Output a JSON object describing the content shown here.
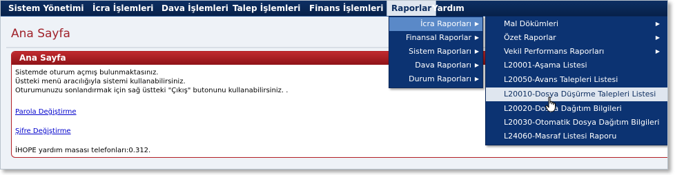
{
  "menubar": {
    "items": [
      {
        "label": "Sistem Yönetimi"
      },
      {
        "label": "İcra İşlemleri"
      },
      {
        "label": "Dava İşlemleri"
      },
      {
        "label": "Talep İşlemleri"
      },
      {
        "label": "Finans İşlemleri"
      },
      {
        "label": "Raporlar"
      },
      {
        "label": "Yardım"
      }
    ],
    "active": "Raporlar"
  },
  "page": {
    "title": "Ana Sayfa"
  },
  "panel": {
    "title": "Ana Sayfa",
    "lines": [
      "Sistemde oturum açmış bulunmaktasınız.",
      "Üstteki menü aracılığıyla sistemi kullanabilirsiniz.",
      "Oturumunuzu sonlandırmak için sağ üstteki \"Çıkış\" butonunu kullanabilirsiniz. ."
    ],
    "links": [
      {
        "label": "Parola Değiştirme"
      },
      {
        "label": "Şifre Değiştirme"
      }
    ],
    "footer": "İHOPE yardım masası telefonları:0.312."
  },
  "raporlar_menu": {
    "items": [
      {
        "label": "İcra Raporları",
        "has_submenu": true
      },
      {
        "label": "Finansal Raporlar",
        "has_submenu": true
      },
      {
        "label": "Sistem Raporları",
        "has_submenu": true
      },
      {
        "label": "Dava Raporları",
        "has_submenu": true
      },
      {
        "label": "Durum Raporları",
        "has_submenu": true
      }
    ],
    "highlighted": "İcra Raporları"
  },
  "icra_raporlari_menu": {
    "items": [
      {
        "label": "Mal Dökümleri",
        "has_submenu": true
      },
      {
        "label": "Özet Raporlar",
        "has_submenu": true
      },
      {
        "label": "Vekil Performans Raporları",
        "has_submenu": true
      },
      {
        "label": "L20001-Aşama Listesi",
        "has_submenu": false
      },
      {
        "label": "L20050-Avans Talepleri Listesi",
        "has_submenu": false
      },
      {
        "label": "L20010-Dosya Düşürme Talepleri Listesi",
        "has_submenu": false
      },
      {
        "label": "L20020-Dosya Dağıtım Bilgileri",
        "has_submenu": false
      },
      {
        "label": "L20030-Otomatik Dosya Dağıtım Bilgileri",
        "has_submenu": false
      },
      {
        "label": "L24060-Masraf Listesi Raporu",
        "has_submenu": false
      }
    ],
    "highlighted": "L20010-Dosya Düşürme Talepleri Listesi"
  },
  "icons": {
    "submenu_arrow": "triangle-right-icon",
    "cursor": "hand-pointer-icon"
  },
  "colors": {
    "menubar_bg": "#0b2a5a",
    "menu_bg": "#0c3372",
    "menu_highlight": "#5a89c8",
    "panel_accent": "#b31f24",
    "title_color": "#a0232b",
    "link_color": "#0000cc"
  }
}
